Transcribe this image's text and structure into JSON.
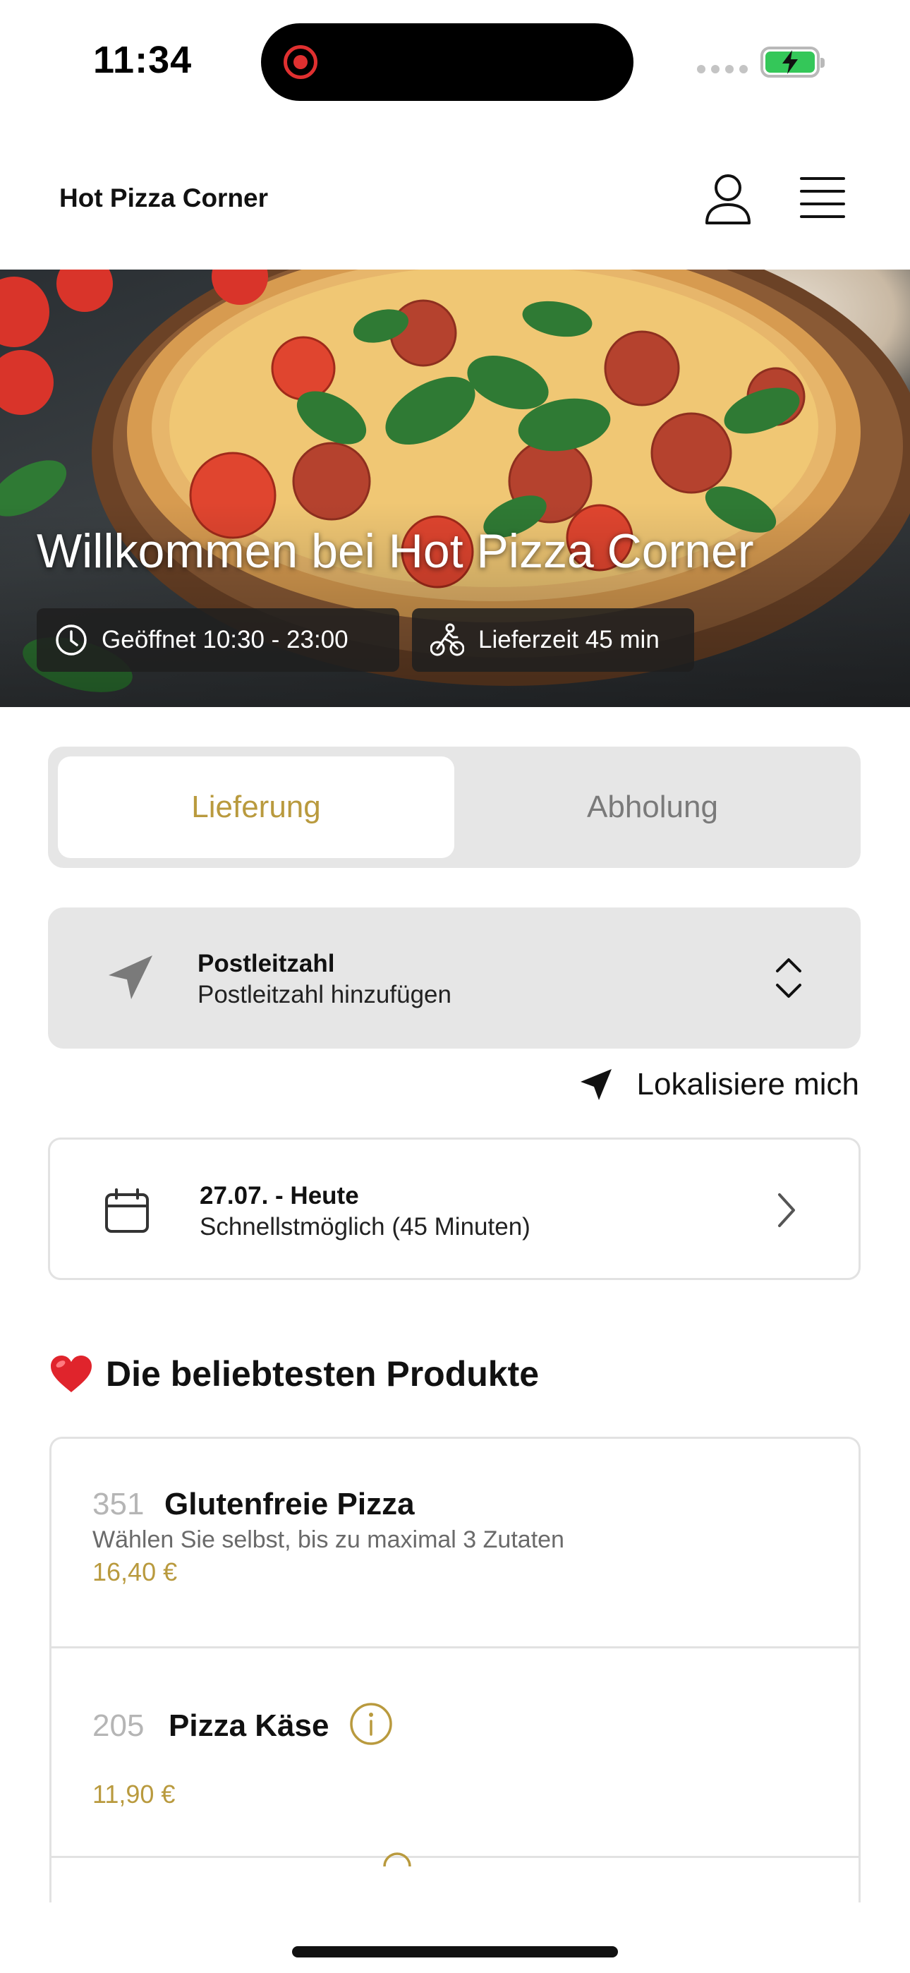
{
  "status_bar": {
    "time": "11:34"
  },
  "header": {
    "brand": "Hot Pizza Corner"
  },
  "hero": {
    "title": "Willkommen bei Hot Pizza Corner",
    "hours": "Geöffnet 10:30 - 23:00",
    "delivery_time": "Lieferzeit 45 min"
  },
  "order_mode": {
    "options": [
      "Lieferung",
      "Abholung"
    ],
    "selected": "Lieferung"
  },
  "postcode": {
    "label": "Postleitzahl",
    "placeholder": "Postleitzahl hinzufügen"
  },
  "locate_label": "Lokalisiere mich",
  "delivery_date": {
    "title": "27.07. - Heute",
    "subtitle": "Schnellstmöglich (45 Minuten)"
  },
  "popular": {
    "title": "Die beliebtesten Produkte",
    "items": [
      {
        "number": "351",
        "name": "Glutenfreie Pizza",
        "description": "Wählen Sie selbst, bis zu maximal 3 Zutaten",
        "price": "16,40 €"
      },
      {
        "number": "205",
        "name": "Pizza Käse",
        "price": "11,90 €"
      }
    ]
  },
  "colors": {
    "accent": "#b99a3e",
    "battery": "#34c759",
    "surface": "#e6e6e6"
  }
}
